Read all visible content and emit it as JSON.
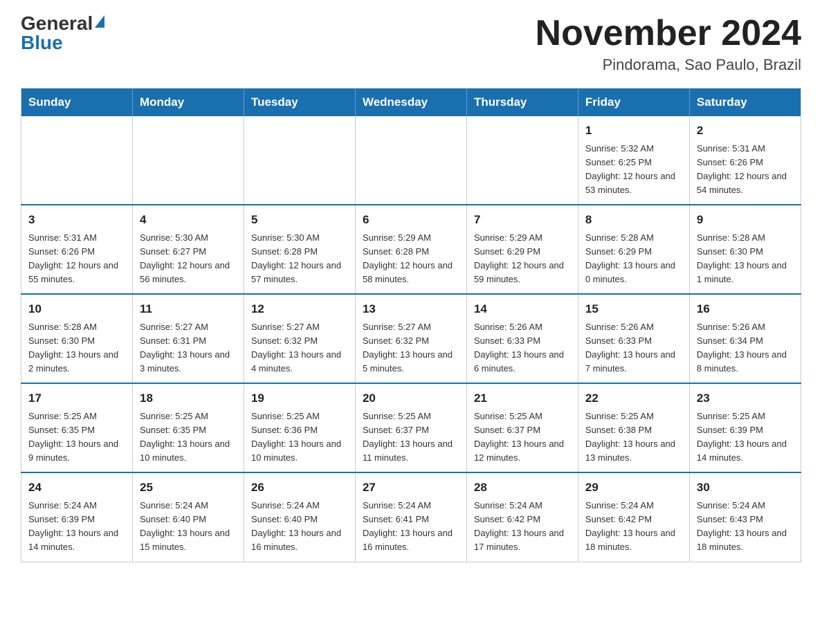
{
  "header": {
    "logo_general": "General",
    "logo_blue": "Blue",
    "month_title": "November 2024",
    "location": "Pindorama, Sao Paulo, Brazil"
  },
  "days_of_week": [
    "Sunday",
    "Monday",
    "Tuesday",
    "Wednesday",
    "Thursday",
    "Friday",
    "Saturday"
  ],
  "weeks": [
    [
      {
        "day": "",
        "info": ""
      },
      {
        "day": "",
        "info": ""
      },
      {
        "day": "",
        "info": ""
      },
      {
        "day": "",
        "info": ""
      },
      {
        "day": "",
        "info": ""
      },
      {
        "day": "1",
        "info": "Sunrise: 5:32 AM\nSunset: 6:25 PM\nDaylight: 12 hours and 53 minutes."
      },
      {
        "day": "2",
        "info": "Sunrise: 5:31 AM\nSunset: 6:26 PM\nDaylight: 12 hours and 54 minutes."
      }
    ],
    [
      {
        "day": "3",
        "info": "Sunrise: 5:31 AM\nSunset: 6:26 PM\nDaylight: 12 hours and 55 minutes."
      },
      {
        "day": "4",
        "info": "Sunrise: 5:30 AM\nSunset: 6:27 PM\nDaylight: 12 hours and 56 minutes."
      },
      {
        "day": "5",
        "info": "Sunrise: 5:30 AM\nSunset: 6:28 PM\nDaylight: 12 hours and 57 minutes."
      },
      {
        "day": "6",
        "info": "Sunrise: 5:29 AM\nSunset: 6:28 PM\nDaylight: 12 hours and 58 minutes."
      },
      {
        "day": "7",
        "info": "Sunrise: 5:29 AM\nSunset: 6:29 PM\nDaylight: 12 hours and 59 minutes."
      },
      {
        "day": "8",
        "info": "Sunrise: 5:28 AM\nSunset: 6:29 PM\nDaylight: 13 hours and 0 minutes."
      },
      {
        "day": "9",
        "info": "Sunrise: 5:28 AM\nSunset: 6:30 PM\nDaylight: 13 hours and 1 minute."
      }
    ],
    [
      {
        "day": "10",
        "info": "Sunrise: 5:28 AM\nSunset: 6:30 PM\nDaylight: 13 hours and 2 minutes."
      },
      {
        "day": "11",
        "info": "Sunrise: 5:27 AM\nSunset: 6:31 PM\nDaylight: 13 hours and 3 minutes."
      },
      {
        "day": "12",
        "info": "Sunrise: 5:27 AM\nSunset: 6:32 PM\nDaylight: 13 hours and 4 minutes."
      },
      {
        "day": "13",
        "info": "Sunrise: 5:27 AM\nSunset: 6:32 PM\nDaylight: 13 hours and 5 minutes."
      },
      {
        "day": "14",
        "info": "Sunrise: 5:26 AM\nSunset: 6:33 PM\nDaylight: 13 hours and 6 minutes."
      },
      {
        "day": "15",
        "info": "Sunrise: 5:26 AM\nSunset: 6:33 PM\nDaylight: 13 hours and 7 minutes."
      },
      {
        "day": "16",
        "info": "Sunrise: 5:26 AM\nSunset: 6:34 PM\nDaylight: 13 hours and 8 minutes."
      }
    ],
    [
      {
        "day": "17",
        "info": "Sunrise: 5:25 AM\nSunset: 6:35 PM\nDaylight: 13 hours and 9 minutes."
      },
      {
        "day": "18",
        "info": "Sunrise: 5:25 AM\nSunset: 6:35 PM\nDaylight: 13 hours and 10 minutes."
      },
      {
        "day": "19",
        "info": "Sunrise: 5:25 AM\nSunset: 6:36 PM\nDaylight: 13 hours and 10 minutes."
      },
      {
        "day": "20",
        "info": "Sunrise: 5:25 AM\nSunset: 6:37 PM\nDaylight: 13 hours and 11 minutes."
      },
      {
        "day": "21",
        "info": "Sunrise: 5:25 AM\nSunset: 6:37 PM\nDaylight: 13 hours and 12 minutes."
      },
      {
        "day": "22",
        "info": "Sunrise: 5:25 AM\nSunset: 6:38 PM\nDaylight: 13 hours and 13 minutes."
      },
      {
        "day": "23",
        "info": "Sunrise: 5:25 AM\nSunset: 6:39 PM\nDaylight: 13 hours and 14 minutes."
      }
    ],
    [
      {
        "day": "24",
        "info": "Sunrise: 5:24 AM\nSunset: 6:39 PM\nDaylight: 13 hours and 14 minutes."
      },
      {
        "day": "25",
        "info": "Sunrise: 5:24 AM\nSunset: 6:40 PM\nDaylight: 13 hours and 15 minutes."
      },
      {
        "day": "26",
        "info": "Sunrise: 5:24 AM\nSunset: 6:40 PM\nDaylight: 13 hours and 16 minutes."
      },
      {
        "day": "27",
        "info": "Sunrise: 5:24 AM\nSunset: 6:41 PM\nDaylight: 13 hours and 16 minutes."
      },
      {
        "day": "28",
        "info": "Sunrise: 5:24 AM\nSunset: 6:42 PM\nDaylight: 13 hours and 17 minutes."
      },
      {
        "day": "29",
        "info": "Sunrise: 5:24 AM\nSunset: 6:42 PM\nDaylight: 13 hours and 18 minutes."
      },
      {
        "day": "30",
        "info": "Sunrise: 5:24 AM\nSunset: 6:43 PM\nDaylight: 13 hours and 18 minutes."
      }
    ]
  ]
}
